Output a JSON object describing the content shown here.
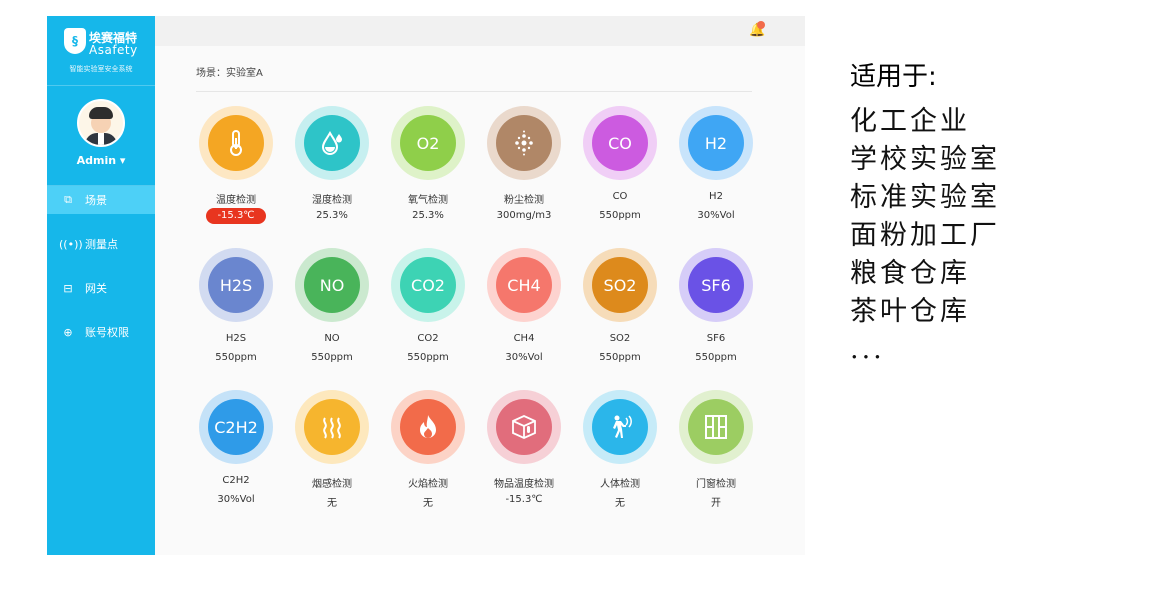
{
  "sidebar": {
    "brand_cn": "埃赛福特",
    "brand_en": "Asafety",
    "tagline": "智能实验室安全系统",
    "user_name": "Admin ▾",
    "items": [
      {
        "label": "场景",
        "icon": "scene-icon"
      },
      {
        "label": "测量点",
        "icon": "signal-icon"
      },
      {
        "label": "网关",
        "icon": "gateway-icon"
      },
      {
        "label": "账号权限",
        "icon": "lock-icon"
      }
    ]
  },
  "main": {
    "breadcrumb": "场景：实验室A",
    "sensors": [
      {
        "title": "温度检测",
        "value": "-15.3℃",
        "alarm": true,
        "icon": "thermometer-icon",
        "color": "#f4a623",
        "ring": "#fde7c3"
      },
      {
        "title": "湿度检测",
        "value": "25.3%",
        "icon": "droplet-icon",
        "color": "#2ec4c8",
        "ring": "#c6eff0"
      },
      {
        "title": "氧气检测",
        "value": "25.3%",
        "text": "O2",
        "color": "#8fcf4a",
        "ring": "#def2c8"
      },
      {
        "title": "粉尘检测",
        "value": "300mg/m3",
        "icon": "dust-icon",
        "color": "#b08767",
        "ring": "#ead9cc"
      },
      {
        "title": "CO",
        "value": "550ppm",
        "text": "CO",
        "color": "#cc5be0",
        "ring": "#f0cef6"
      },
      {
        "title": "H2",
        "value": "30%Vol",
        "text": "H2",
        "color": "#3fa6f4",
        "ring": "#c8e4fb"
      },
      {
        "title": "H2S",
        "value": "550ppm",
        "text": "H2S",
        "color": "#6a86cf",
        "ring": "#d2dbf1"
      },
      {
        "title": "NO",
        "value": "550ppm",
        "text": "NO",
        "color": "#49b45a",
        "ring": "#cbe9cf"
      },
      {
        "title": "CO2",
        "value": "550ppm",
        "text": "CO2",
        "color": "#3dd3b4",
        "ring": "#c8f3ea"
      },
      {
        "title": "CH4",
        "value": "30%Vol",
        "text": "CH4",
        "color": "#f5776c",
        "ring": "#fdd3cf"
      },
      {
        "title": "SO2",
        "value": "550ppm",
        "text": "SO2",
        "color": "#dd8a1c",
        "ring": "#f6dcb9"
      },
      {
        "title": "SF6",
        "value": "550ppm",
        "text": "SF6",
        "color": "#6a52e6",
        "ring": "#d6cdf8"
      },
      {
        "title": "C2H2",
        "value": "30%Vol",
        "text": "C2H2",
        "color": "#2f9be8",
        "ring": "#c5e2f8"
      },
      {
        "title": "烟感检测",
        "value": "无",
        "icon": "smoke-icon",
        "color": "#f6b52e",
        "ring": "#fde8bd"
      },
      {
        "title": "火焰检测",
        "value": "无",
        "icon": "flame-icon",
        "color": "#f26b4a",
        "ring": "#fcd3c6"
      },
      {
        "title": "物品温度检测",
        "value": "-15.3℃",
        "icon": "box-temperature-icon",
        "color": "#e16d7c",
        "ring": "#f6d0d6"
      },
      {
        "title": "人体检测",
        "value": "无",
        "icon": "person-motion-icon",
        "color": "#2bb6ea",
        "ring": "#c6ebf8"
      },
      {
        "title": "门窗检测",
        "value": "开",
        "icon": "door-icon",
        "color": "#9ccd62",
        "ring": "#e1f0cf"
      }
    ]
  },
  "right_panel": {
    "heading": "适用于:",
    "lines": [
      "化工企业",
      "学校实验室",
      "标准实验室",
      "面粉加工厂",
      "粮食仓库",
      "茶叶仓库",
      "..."
    ]
  }
}
